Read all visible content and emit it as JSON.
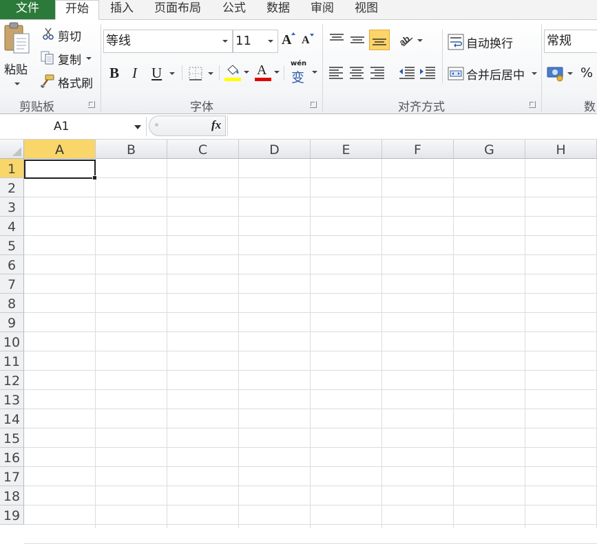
{
  "tabs": [
    "文件",
    "开始",
    "插入",
    "页面布局",
    "公式",
    "数据",
    "审阅",
    "视图"
  ],
  "clipboard": {
    "paste_label": "粘贴",
    "cut_label": "剪切",
    "copy_label": "复制",
    "format_painter_label": "格式刷",
    "group_label": "剪贴板"
  },
  "font": {
    "font_name": "等线",
    "font_size": "11",
    "bold_label": "B",
    "italic_label": "I",
    "underline_label": "U",
    "font_color_letter": "A",
    "phonetic_label": "wén",
    "phonetic_char": "变",
    "group_label": "字体",
    "highlight_color": "#ffff00",
    "font_color": "#e00000"
  },
  "alignment": {
    "wrap_text_label": "自动换行",
    "merge_center_label": "合并后居中",
    "group_label": "对齐方式"
  },
  "number": {
    "format_value": "常规",
    "percent_label": "%",
    "group_label": "数"
  },
  "formula_bar": {
    "name_box": "A1",
    "fx_label": "fx",
    "formula": ""
  },
  "sheet": {
    "columns": [
      "A",
      "B",
      "C",
      "D",
      "E",
      "F",
      "G",
      "H"
    ],
    "rows": [
      "1",
      "2",
      "3",
      "4",
      "5",
      "6",
      "7",
      "8",
      "9",
      "10",
      "11",
      "12",
      "13",
      "14",
      "15",
      "16",
      "17",
      "18",
      "19"
    ],
    "selected_cell": "A1"
  },
  "colors": {
    "file_tab": "#2c7a3a",
    "selected_header": "#f8d66a",
    "active_align_button": "#fcd467"
  }
}
